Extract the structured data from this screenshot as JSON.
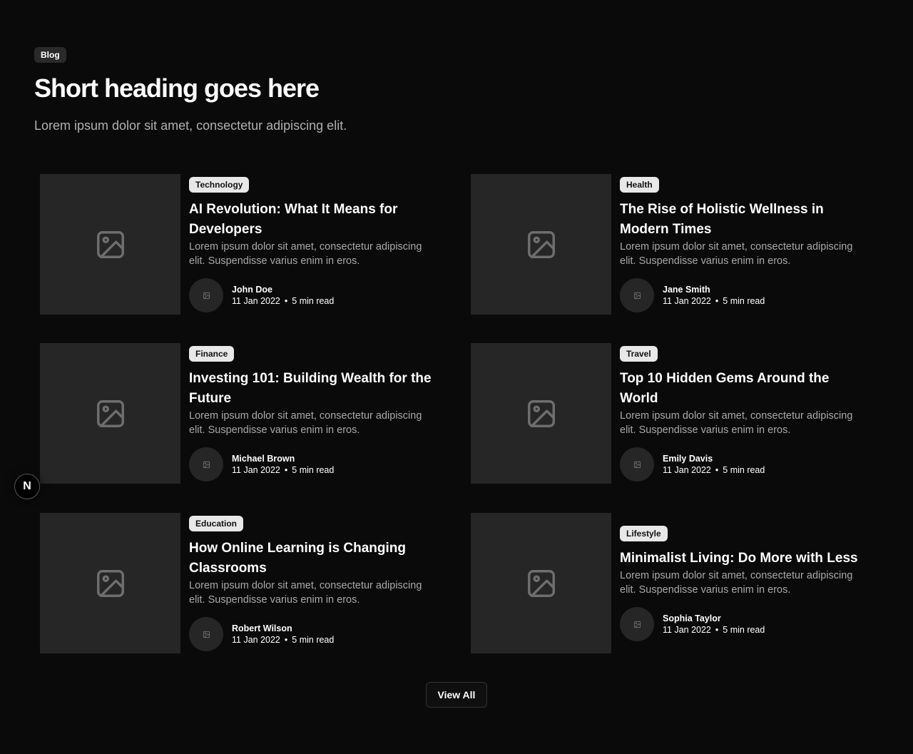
{
  "header": {
    "eyebrow": "Blog",
    "heading": "Short heading goes here",
    "subheading": "Lorem ipsum dolor sit amet, consectetur adipiscing elit."
  },
  "posts": [
    {
      "tag": "Technology",
      "title": "AI Revolution: What It Means for Developers",
      "description": "Lorem ipsum dolor sit amet, consectetur adipiscing elit. Suspendisse varius enim in eros.",
      "author": "John Doe",
      "date": "11 Jan 2022",
      "read_time": "5 min read"
    },
    {
      "tag": "Health",
      "title": "The Rise of Holistic Wellness in Modern Times",
      "description": "Lorem ipsum dolor sit amet, consectetur adipiscing elit. Suspendisse varius enim in eros.",
      "author": "Jane Smith",
      "date": "11 Jan 2022",
      "read_time": "5 min read"
    },
    {
      "tag": "Finance",
      "title": "Investing 101: Building Wealth for the Future",
      "description": "Lorem ipsum dolor sit amet, consectetur adipiscing elit. Suspendisse varius enim in eros.",
      "author": "Michael Brown",
      "date": "11 Jan 2022",
      "read_time": "5 min read"
    },
    {
      "tag": "Travel",
      "title": "Top 10 Hidden Gems Around the World",
      "description": "Lorem ipsum dolor sit amet, consectetur adipiscing elit. Suspendisse varius enim in eros.",
      "author": "Emily Davis",
      "date": "11 Jan 2022",
      "read_time": "5 min read"
    },
    {
      "tag": "Education",
      "title": "How Online Learning is Changing Classrooms",
      "description": "Lorem ipsum dolor sit amet, consectetur adipiscing elit. Suspendisse varius enim in eros.",
      "author": "Robert Wilson",
      "date": "11 Jan 2022",
      "read_time": "5 min read"
    },
    {
      "tag": "Lifestyle",
      "title": "Minimalist Living: Do More with Less",
      "description": "Lorem ipsum dolor sit amet, consectetur adipiscing elit. Suspendisse varius enim in eros.",
      "author": "Sophia Taylor",
      "date": "11 Jan 2022",
      "read_time": "5 min read"
    }
  ],
  "meta_separator": "•",
  "view_all_label": "View All",
  "floating_button": {
    "label": "N",
    "icon": "nextjs-logo-icon"
  },
  "icons": {
    "thumbnail": "image-placeholder-icon",
    "avatar": "image-placeholder-icon"
  },
  "colors": {
    "background": "#0a0a0a",
    "card_placeholder": "#262626",
    "tag_background": "#e8e8e8",
    "muted_text": "#a8a8a8"
  }
}
